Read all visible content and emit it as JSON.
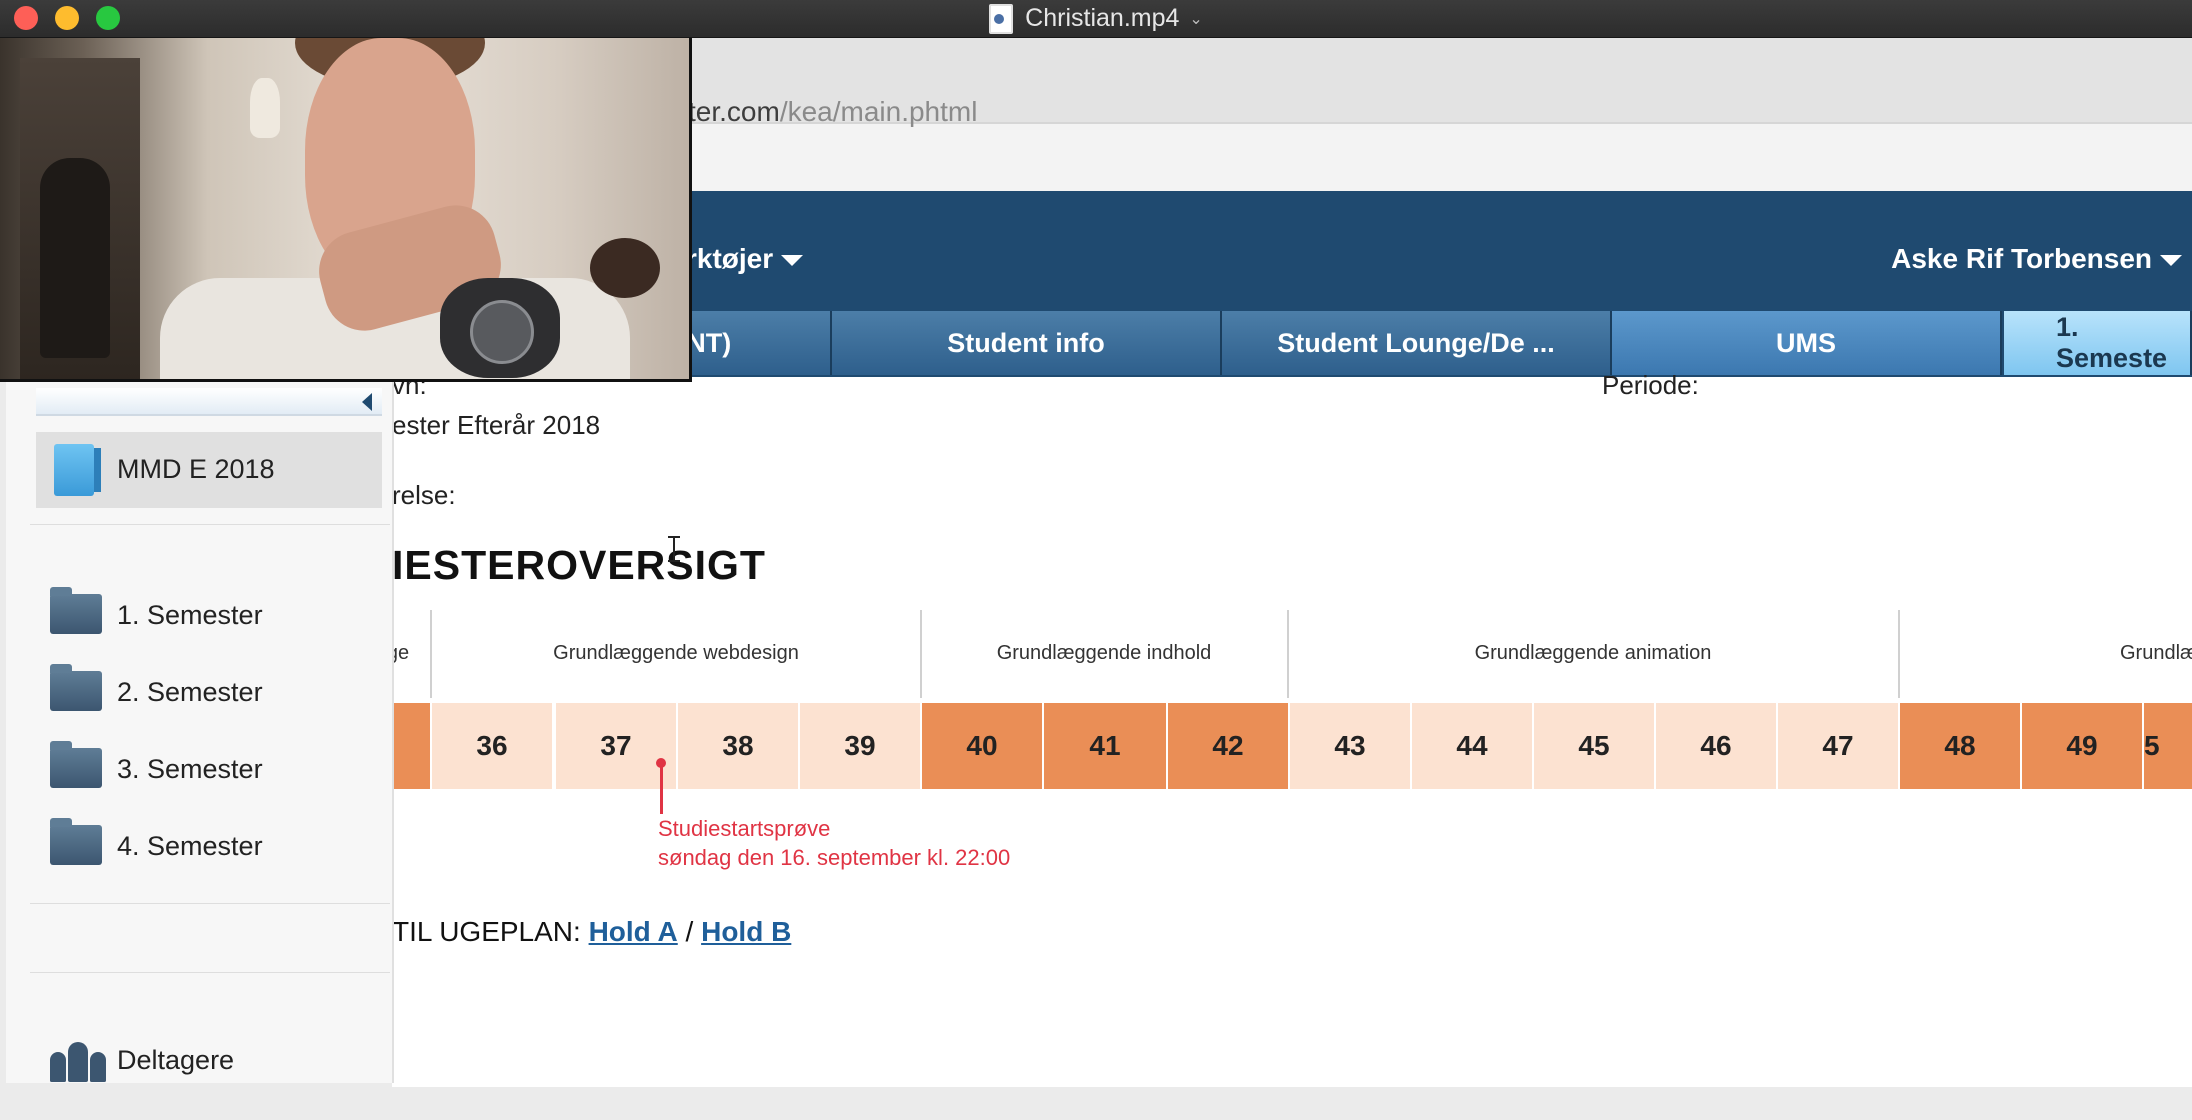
{
  "window": {
    "title": "Christian.mp4"
  },
  "browser": {
    "url_domain": "ter.com",
    "url_path": "/kea/main.phtml"
  },
  "nav": {
    "tools_label": "rktøjer",
    "user_name": "Aske Rif Torbensen",
    "tabs": [
      {
        "label": "INT)"
      },
      {
        "label": "Student info"
      },
      {
        "label": "Student Lounge/De ..."
      },
      {
        "label": "UMS"
      },
      {
        "label": "1. Semeste"
      }
    ]
  },
  "page": {
    "label_navn": "vn:",
    "label_periode": "Periode:",
    "semester_value": "ester Efterår 2018",
    "label_beskrivelse": "relse:",
    "section_title": "IESTEROVERSIGT",
    "courses": [
      {
        "label": "ge"
      },
      {
        "label": "Grundlæggende webdesign"
      },
      {
        "label": "Grundlæggende indhold"
      },
      {
        "label": "Grundlæggende animation"
      },
      {
        "label": "Grundlæggende"
      }
    ],
    "weeks": [
      {
        "label": "",
        "style": "dark"
      },
      {
        "label": "36",
        "style": "light"
      },
      {
        "label": "37",
        "style": "light"
      },
      {
        "label": "38",
        "style": "light"
      },
      {
        "label": "39",
        "style": "light"
      },
      {
        "label": "40",
        "style": "dark"
      },
      {
        "label": "41",
        "style": "dark"
      },
      {
        "label": "42",
        "style": "dark"
      },
      {
        "label": "43",
        "style": "light"
      },
      {
        "label": "44",
        "style": "light"
      },
      {
        "label": "45",
        "style": "light"
      },
      {
        "label": "46",
        "style": "light"
      },
      {
        "label": "47",
        "style": "light"
      },
      {
        "label": "48",
        "style": "dark"
      },
      {
        "label": "49",
        "style": "dark"
      },
      {
        "label": "5",
        "style": "dark"
      }
    ],
    "event": {
      "line1": "Studiestartsprøve",
      "line2": "søndag den 16. september kl. 22:00"
    },
    "ugeplan": {
      "prefix": "TIL UGEPLAN: ",
      "link_a": "Hold A",
      "sep": " / ",
      "link_b": "Hold B"
    }
  },
  "sidebar": {
    "course": "MMD E 2018",
    "semesters": [
      {
        "label": "1. Semester"
      },
      {
        "label": "2. Semester"
      },
      {
        "label": "3. Semester"
      },
      {
        "label": "4. Semester"
      }
    ],
    "participants": "Deltagere"
  },
  "colors": {
    "nav_blue": "#1f4a70",
    "week_dark": "#ea8e56",
    "week_light": "#fce2d1",
    "event_red": "#e03444"
  }
}
